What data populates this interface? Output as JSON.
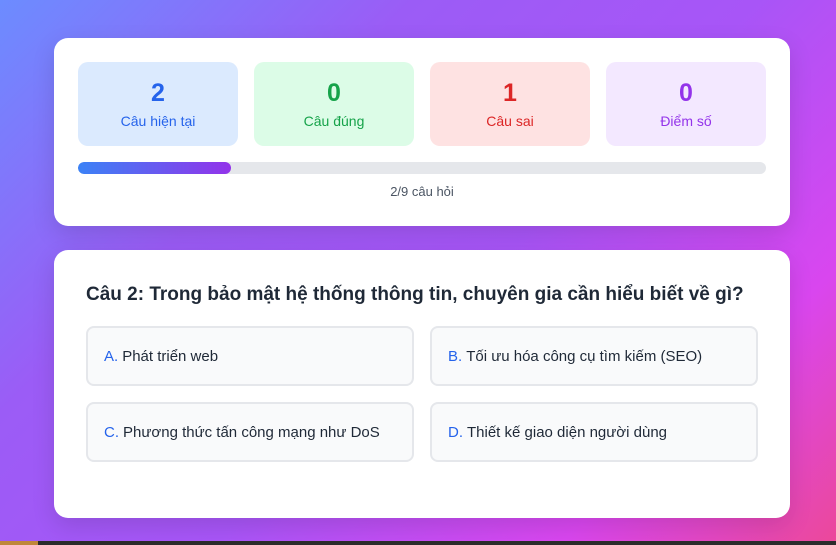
{
  "stats": {
    "current": {
      "value": "2",
      "label": "Câu hiện tại"
    },
    "correct": {
      "value": "0",
      "label": "Câu đúng"
    },
    "wrong": {
      "value": "1",
      "label": "Câu sai"
    },
    "score": {
      "value": "0",
      "label": "Điểm số"
    }
  },
  "progress": {
    "fraction": 0.222,
    "text": "2/9 câu hỏi"
  },
  "question": {
    "title": "Câu 2: Trong bảo mật hệ thống thông tin, chuyên gia cần hiểu biết về gì?",
    "options": [
      {
        "letter": "A.",
        "text": "Phát triển web"
      },
      {
        "letter": "B.",
        "text": "Tối ưu hóa công cụ tìm kiếm (SEO)"
      },
      {
        "letter": "C.",
        "text": "Phương thức tấn công mạng như DoS"
      },
      {
        "letter": "D.",
        "text": "Thiết kế giao diện người dùng"
      }
    ]
  },
  "colors": {
    "current": "#2563eb",
    "correct": "#16a34a",
    "wrong": "#dc2626",
    "score": "#9333ea"
  }
}
